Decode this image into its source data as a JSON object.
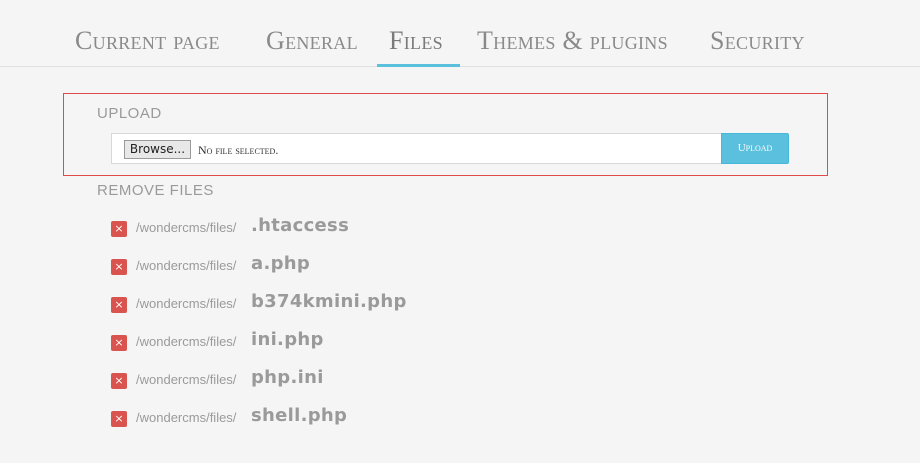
{
  "tabs": [
    {
      "label": "Current page"
    },
    {
      "label": "General"
    },
    {
      "label": "Files"
    },
    {
      "label": "Themes & plugins"
    },
    {
      "label": "Security"
    }
  ],
  "active_tab": "Files",
  "upload": {
    "title": "Upload",
    "browse_label": "Browse...",
    "no_file_text": "No file selected.",
    "button_label": "Upload"
  },
  "remove": {
    "title": "Remove files",
    "delete_glyph": "×",
    "files": [
      {
        "path": "/wondercms/files/",
        "name": ".htaccess"
      },
      {
        "path": "/wondercms/files/",
        "name": "a.php"
      },
      {
        "path": "/wondercms/files/",
        "name": "b374kmini.php"
      },
      {
        "path": "/wondercms/files/",
        "name": "ini.php"
      },
      {
        "path": "/wondercms/files/",
        "name": "php.ini"
      },
      {
        "path": "/wondercms/files/",
        "name": "shell.php"
      }
    ]
  },
  "colors": {
    "accent": "#5bc0de",
    "danger": "#d9534f",
    "highlight_border": "#e04a4a"
  }
}
